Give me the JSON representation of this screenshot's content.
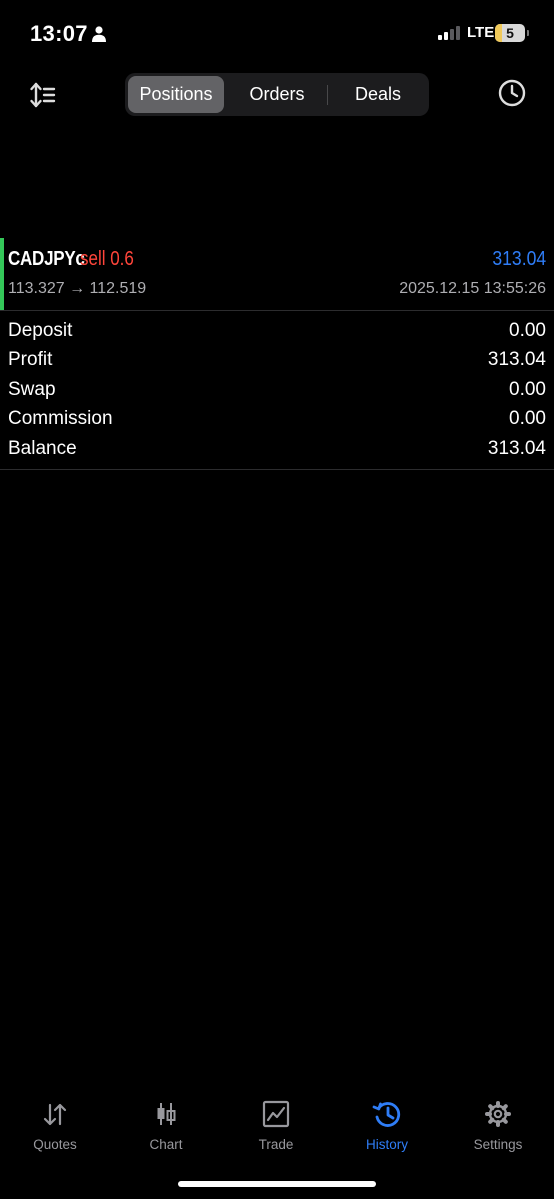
{
  "status_bar": {
    "time": "13:07",
    "network": "LTE",
    "battery": "5"
  },
  "segments": {
    "positions": "Positions",
    "orders": "Orders",
    "deals": "Deals",
    "selected": "Positions"
  },
  "position": {
    "symbol": "CADJPYc",
    "side_lot": "sell 0.6",
    "profit": "313.04",
    "prices": "113.327 → 112.519",
    "time": "2025.12.15 13:55:26",
    "accent_color": "#34c759"
  },
  "summary": [
    {
      "label": "Deposit",
      "value": "0.00"
    },
    {
      "label": "Profit",
      "value": "313.04"
    },
    {
      "label": "Swap",
      "value": "0.00"
    },
    {
      "label": "Commission",
      "value": "0.00"
    },
    {
      "label": "Balance",
      "value": "313.04"
    }
  ],
  "tabs": [
    {
      "label": "Quotes",
      "icon": "arrows-up-down-icon"
    },
    {
      "label": "Chart",
      "icon": "candlestick-icon"
    },
    {
      "label": "Trade",
      "icon": "trend-chart-icon"
    },
    {
      "label": "History",
      "icon": "history-icon",
      "active": true
    },
    {
      "label": "Settings",
      "icon": "gear-icon"
    }
  ],
  "colors": {
    "background": "#000000",
    "accent_blue": "#2f7df6",
    "sell_red": "#ff453a",
    "buy_green": "#34c759"
  }
}
